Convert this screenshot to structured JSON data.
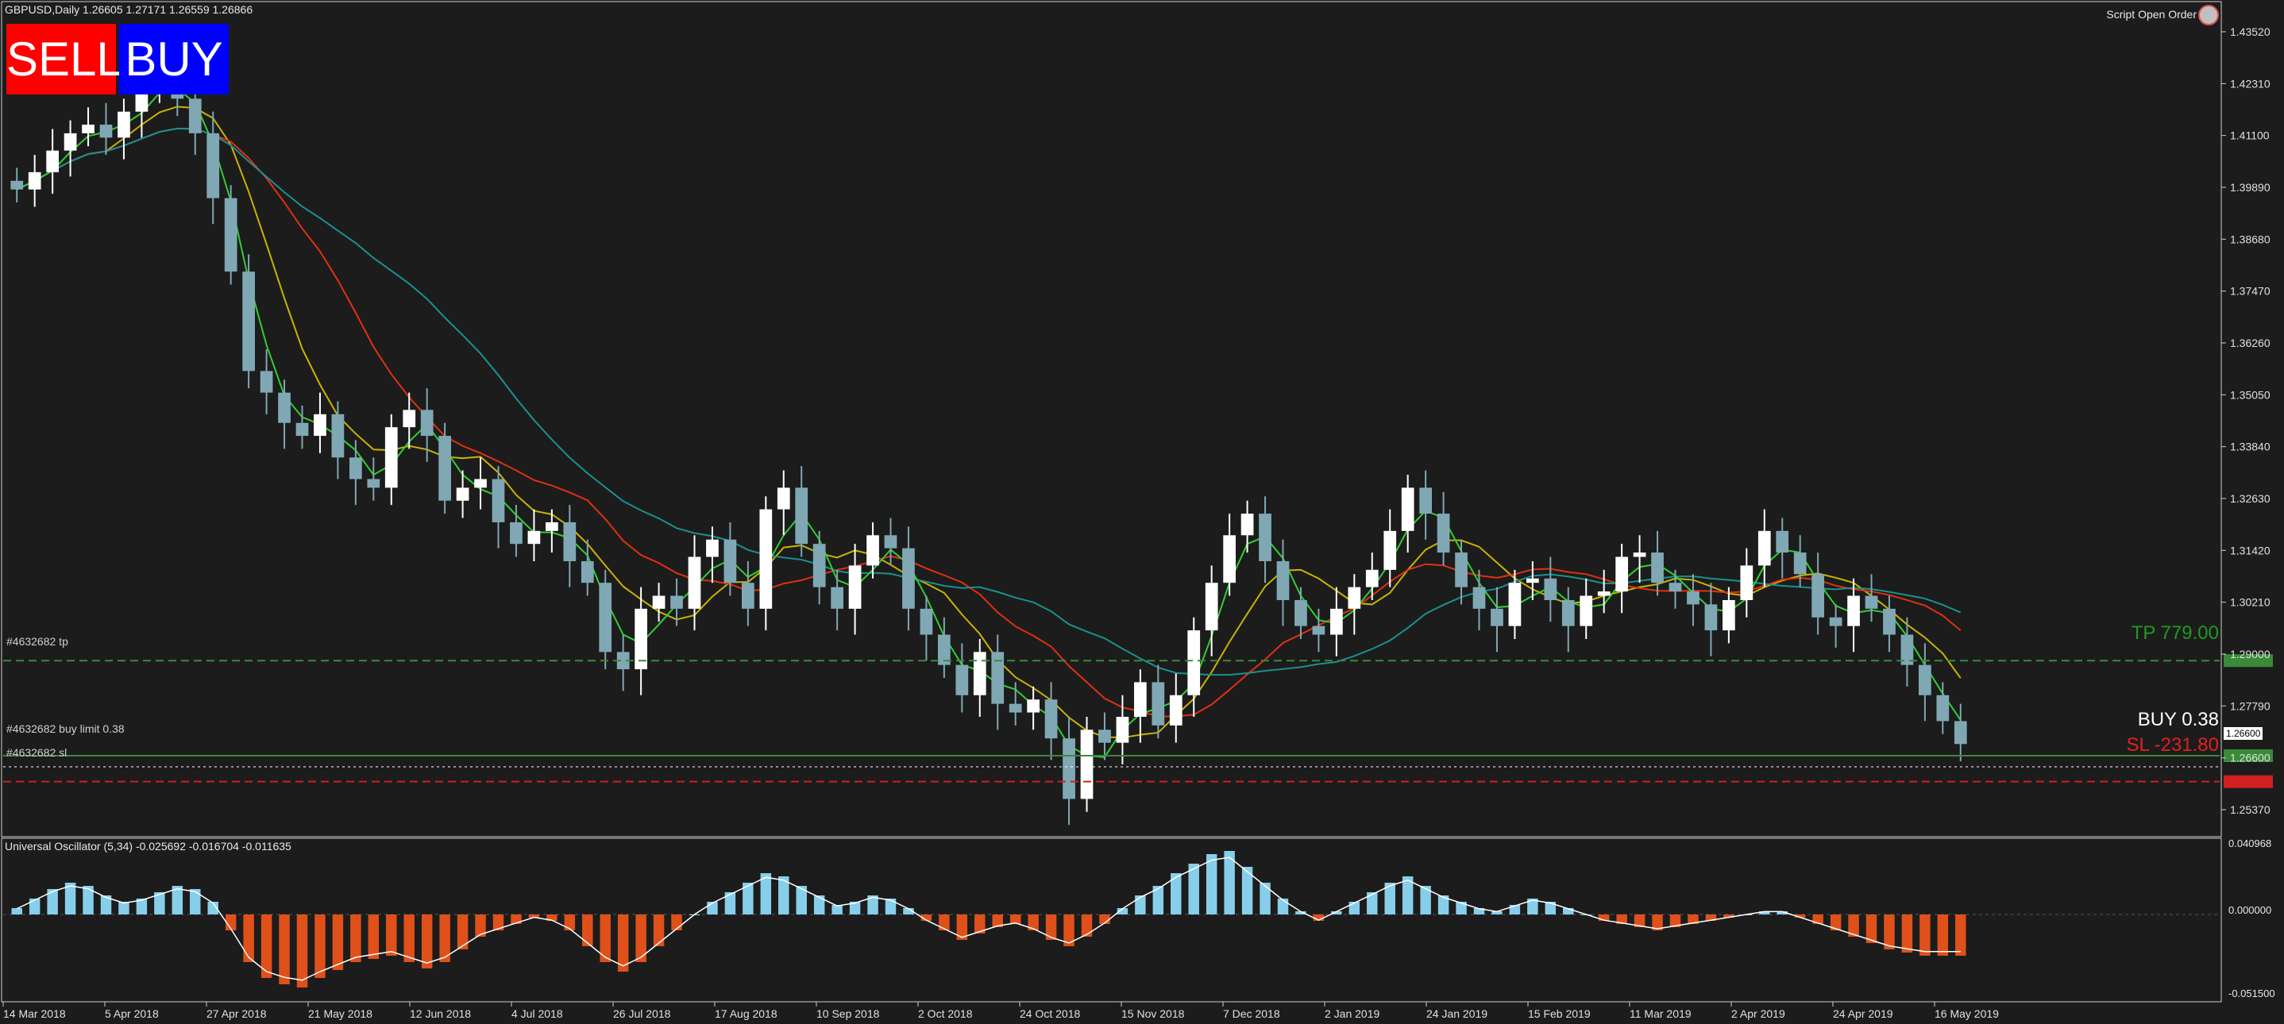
{
  "header": {
    "symbol_info": "GBPUSD,Daily  1.26605 1.27171 1.26559 1.26866",
    "script_label": "Script Open Order"
  },
  "buttons": {
    "sell": "SELL",
    "buy": "BUY"
  },
  "trade_lines": {
    "tp_label": "#4632682 tp",
    "buy_limit_label": "#4632682 buy limit 0.38",
    "sl_label": "#4632682 sl",
    "tp_text": "TP  779.00",
    "buy_text": "BUY  0.38",
    "sl_text": "SL  -231.80",
    "current_price": "1.26600"
  },
  "oscillator": {
    "label": "Universal Oscillator (5,34) -0.025692 -0.016704 -0.011635",
    "scale_labels": [
      "0.040968",
      "0.000000",
      "-0.051500"
    ]
  },
  "price_axis": [
    "1.43520",
    "1.42310",
    "1.41100",
    "1.39890",
    "1.38680",
    "1.37470",
    "1.36260",
    "1.35050",
    "1.33840",
    "1.32630",
    "1.31420",
    "1.30210",
    "1.29000",
    "1.27790",
    "1.26600",
    "1.25370"
  ],
  "time_axis": [
    "14 Mar 2018",
    "5 Apr 2018",
    "27 Apr 2018",
    "21 May 2018",
    "12 Jun 2018",
    "4 Jul 2018",
    "26 Jul 2018",
    "17 Aug 2018",
    "10 Sep 2018",
    "2 Oct 2018",
    "24 Oct 2018",
    "15 Nov 2018",
    "7 Dec 2018",
    "2 Jan 2019",
    "24 Jan 2019",
    "15 Feb 2019",
    "11 Mar 2019",
    "2 Apr 2019",
    "24 Apr 2019",
    "16 May 2019"
  ],
  "colors": {
    "background": "#1c1c1c",
    "bull_candle": "#ffffff",
    "bear_candle": "#7fa8b4",
    "ma_red": "#e03010",
    "ma_yellow": "#c8b400",
    "ma_teal": "#1a9090",
    "ma_green": "#30d030",
    "tp_line": "#3a8a3a",
    "sl_line": "#d02020",
    "osc_pos": "#87ceeb",
    "osc_neg": "#e0501a"
  },
  "chart_data": {
    "type": "candlestick",
    "symbol": "GBPUSD",
    "timeframe": "Daily",
    "ylim": [
      1.248,
      1.439
    ],
    "levels": {
      "tp": 1.288,
      "buy_limit": 1.266,
      "sl": 1.26
    },
    "closes": [
      1.397,
      1.401,
      1.406,
      1.41,
      1.412,
      1.409,
      1.415,
      1.42,
      1.423,
      1.418,
      1.41,
      1.395,
      1.378,
      1.355,
      1.35,
      1.343,
      1.34,
      1.345,
      1.335,
      1.33,
      1.328,
      1.342,
      1.346,
      1.34,
      1.325,
      1.328,
      1.33,
      1.32,
      1.315,
      1.318,
      1.32,
      1.311,
      1.306,
      1.29,
      1.286,
      1.3,
      1.303,
      1.3,
      1.312,
      1.316,
      1.306,
      1.3,
      1.323,
      1.328,
      1.315,
      1.305,
      1.3,
      1.31,
      1.317,
      1.314,
      1.3,
      1.294,
      1.287,
      1.28,
      1.29,
      1.278,
      1.276,
      1.279,
      1.27,
      1.256,
      1.272,
      1.269,
      1.275,
      1.283,
      1.273,
      1.28,
      1.295,
      1.306,
      1.317,
      1.322,
      1.311,
      1.302,
      1.296,
      1.294,
      1.3,
      1.305,
      1.309,
      1.318,
      1.328,
      1.322,
      1.313,
      1.305,
      1.3,
      1.296,
      1.306,
      1.307,
      1.302,
      1.296,
      1.303,
      1.304,
      1.312,
      1.313,
      1.306,
      1.304,
      1.301,
      1.295,
      1.302,
      1.31,
      1.318,
      1.313,
      1.308,
      1.298,
      1.296,
      1.303,
      1.3,
      1.294,
      1.287,
      1.28,
      1.274,
      1.2687
    ]
  },
  "oscillator_data": [
    0.004,
    0.01,
    0.016,
    0.02,
    0.018,
    0.012,
    0.008,
    0.01,
    0.014,
    0.018,
    0.016,
    0.008,
    -0.01,
    -0.03,
    -0.04,
    -0.044,
    -0.046,
    -0.04,
    -0.035,
    -0.03,
    -0.028,
    -0.026,
    -0.03,
    -0.034,
    -0.03,
    -0.022,
    -0.014,
    -0.01,
    -0.006,
    -0.002,
    -0.004,
    -0.01,
    -0.02,
    -0.03,
    -0.036,
    -0.03,
    -0.02,
    -0.01,
    0.0,
    0.008,
    0.014,
    0.02,
    0.026,
    0.024,
    0.018,
    0.012,
    0.006,
    0.008,
    0.012,
    0.01,
    0.004,
    -0.004,
    -0.01,
    -0.016,
    -0.012,
    -0.008,
    -0.006,
    -0.01,
    -0.016,
    -0.02,
    -0.014,
    -0.006,
    0.004,
    0.012,
    0.018,
    0.026,
    0.032,
    0.038,
    0.04,
    0.03,
    0.02,
    0.01,
    0.002,
    -0.004,
    0.002,
    0.008,
    0.014,
    0.02,
    0.024,
    0.018,
    0.012,
    0.008,
    0.004,
    0.002,
    0.006,
    0.01,
    0.008,
    0.004,
    0.0,
    -0.004,
    -0.006,
    -0.008,
    -0.01,
    -0.008,
    -0.006,
    -0.004,
    -0.002,
    0.0,
    0.002,
    0.002,
    -0.002,
    -0.006,
    -0.01,
    -0.014,
    -0.018,
    -0.022,
    -0.024,
    -0.026,
    -0.026,
    -0.026
  ]
}
